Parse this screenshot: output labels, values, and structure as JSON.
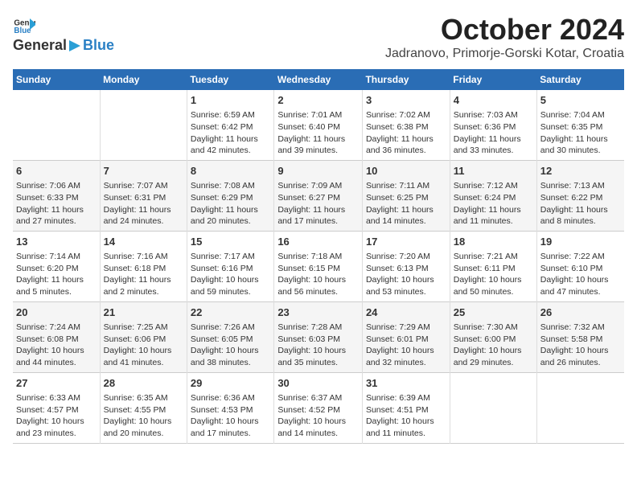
{
  "header": {
    "logo_general": "General",
    "logo_blue": "Blue",
    "title": "October 2024",
    "subtitle": "Jadranovo, Primorje-Gorski Kotar, Croatia"
  },
  "columns": [
    "Sunday",
    "Monday",
    "Tuesday",
    "Wednesday",
    "Thursday",
    "Friday",
    "Saturday"
  ],
  "weeks": [
    [
      {
        "day": "",
        "info": ""
      },
      {
        "day": "",
        "info": ""
      },
      {
        "day": "1",
        "info": "Sunrise: 6:59 AM\nSunset: 6:42 PM\nDaylight: 11 hours and 42 minutes."
      },
      {
        "day": "2",
        "info": "Sunrise: 7:01 AM\nSunset: 6:40 PM\nDaylight: 11 hours and 39 minutes."
      },
      {
        "day": "3",
        "info": "Sunrise: 7:02 AM\nSunset: 6:38 PM\nDaylight: 11 hours and 36 minutes."
      },
      {
        "day": "4",
        "info": "Sunrise: 7:03 AM\nSunset: 6:36 PM\nDaylight: 11 hours and 33 minutes."
      },
      {
        "day": "5",
        "info": "Sunrise: 7:04 AM\nSunset: 6:35 PM\nDaylight: 11 hours and 30 minutes."
      }
    ],
    [
      {
        "day": "6",
        "info": "Sunrise: 7:06 AM\nSunset: 6:33 PM\nDaylight: 11 hours and 27 minutes."
      },
      {
        "day": "7",
        "info": "Sunrise: 7:07 AM\nSunset: 6:31 PM\nDaylight: 11 hours and 24 minutes."
      },
      {
        "day": "8",
        "info": "Sunrise: 7:08 AM\nSunset: 6:29 PM\nDaylight: 11 hours and 20 minutes."
      },
      {
        "day": "9",
        "info": "Sunrise: 7:09 AM\nSunset: 6:27 PM\nDaylight: 11 hours and 17 minutes."
      },
      {
        "day": "10",
        "info": "Sunrise: 7:11 AM\nSunset: 6:25 PM\nDaylight: 11 hours and 14 minutes."
      },
      {
        "day": "11",
        "info": "Sunrise: 7:12 AM\nSunset: 6:24 PM\nDaylight: 11 hours and 11 minutes."
      },
      {
        "day": "12",
        "info": "Sunrise: 7:13 AM\nSunset: 6:22 PM\nDaylight: 11 hours and 8 minutes."
      }
    ],
    [
      {
        "day": "13",
        "info": "Sunrise: 7:14 AM\nSunset: 6:20 PM\nDaylight: 11 hours and 5 minutes."
      },
      {
        "day": "14",
        "info": "Sunrise: 7:16 AM\nSunset: 6:18 PM\nDaylight: 11 hours and 2 minutes."
      },
      {
        "day": "15",
        "info": "Sunrise: 7:17 AM\nSunset: 6:16 PM\nDaylight: 10 hours and 59 minutes."
      },
      {
        "day": "16",
        "info": "Sunrise: 7:18 AM\nSunset: 6:15 PM\nDaylight: 10 hours and 56 minutes."
      },
      {
        "day": "17",
        "info": "Sunrise: 7:20 AM\nSunset: 6:13 PM\nDaylight: 10 hours and 53 minutes."
      },
      {
        "day": "18",
        "info": "Sunrise: 7:21 AM\nSunset: 6:11 PM\nDaylight: 10 hours and 50 minutes."
      },
      {
        "day": "19",
        "info": "Sunrise: 7:22 AM\nSunset: 6:10 PM\nDaylight: 10 hours and 47 minutes."
      }
    ],
    [
      {
        "day": "20",
        "info": "Sunrise: 7:24 AM\nSunset: 6:08 PM\nDaylight: 10 hours and 44 minutes."
      },
      {
        "day": "21",
        "info": "Sunrise: 7:25 AM\nSunset: 6:06 PM\nDaylight: 10 hours and 41 minutes."
      },
      {
        "day": "22",
        "info": "Sunrise: 7:26 AM\nSunset: 6:05 PM\nDaylight: 10 hours and 38 minutes."
      },
      {
        "day": "23",
        "info": "Sunrise: 7:28 AM\nSunset: 6:03 PM\nDaylight: 10 hours and 35 minutes."
      },
      {
        "day": "24",
        "info": "Sunrise: 7:29 AM\nSunset: 6:01 PM\nDaylight: 10 hours and 32 minutes."
      },
      {
        "day": "25",
        "info": "Sunrise: 7:30 AM\nSunset: 6:00 PM\nDaylight: 10 hours and 29 minutes."
      },
      {
        "day": "26",
        "info": "Sunrise: 7:32 AM\nSunset: 5:58 PM\nDaylight: 10 hours and 26 minutes."
      }
    ],
    [
      {
        "day": "27",
        "info": "Sunrise: 6:33 AM\nSunset: 4:57 PM\nDaylight: 10 hours and 23 minutes."
      },
      {
        "day": "28",
        "info": "Sunrise: 6:35 AM\nSunset: 4:55 PM\nDaylight: 10 hours and 20 minutes."
      },
      {
        "day": "29",
        "info": "Sunrise: 6:36 AM\nSunset: 4:53 PM\nDaylight: 10 hours and 17 minutes."
      },
      {
        "day": "30",
        "info": "Sunrise: 6:37 AM\nSunset: 4:52 PM\nDaylight: 10 hours and 14 minutes."
      },
      {
        "day": "31",
        "info": "Sunrise: 6:39 AM\nSunset: 4:51 PM\nDaylight: 10 hours and 11 minutes."
      },
      {
        "day": "",
        "info": ""
      },
      {
        "day": "",
        "info": ""
      }
    ]
  ]
}
